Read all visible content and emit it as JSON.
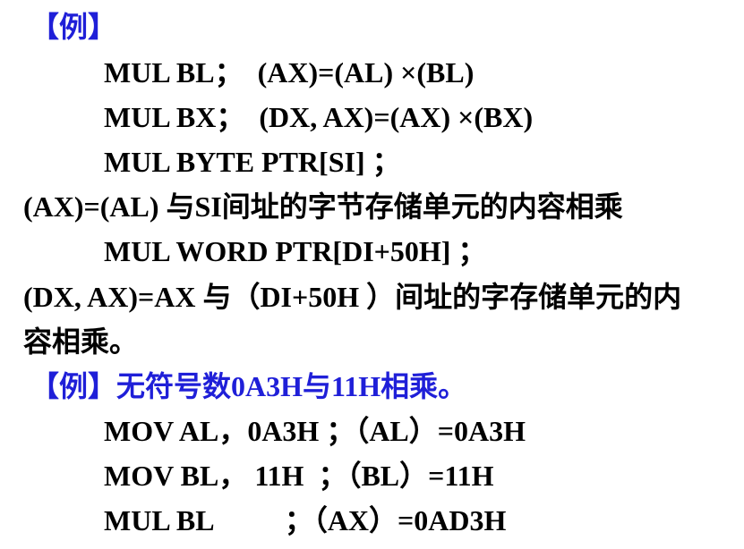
{
  "colors": {
    "text": "#000000",
    "highlight": "#1f1fd8",
    "background": "#ffffff"
  },
  "lines": [
    "【例】",
    "MUL BL；  (AX)=(AL) ×(BL)",
    "MUL BX；  (DX, AX)=(AX) ×(BX)",
    "MUL BYTE PTR[SI] ；",
    "(AX)=(AL) 与SI间址的字节存储单元的内容相乘",
    "MUL WORD PTR[DI+50H] ；",
    "(DX, AX)=AX 与（DI+50H ）间址的字存储单元的内",
    "容相乘。",
    "【例】无符号数0A3H与11H相乘。",
    "MOV AL，0A3H ；（AL）=0A3H",
    "MOV BL， 11H  ；（BL）=11H",
    "MUL BL          ；（AX）=0AD3H"
  ]
}
